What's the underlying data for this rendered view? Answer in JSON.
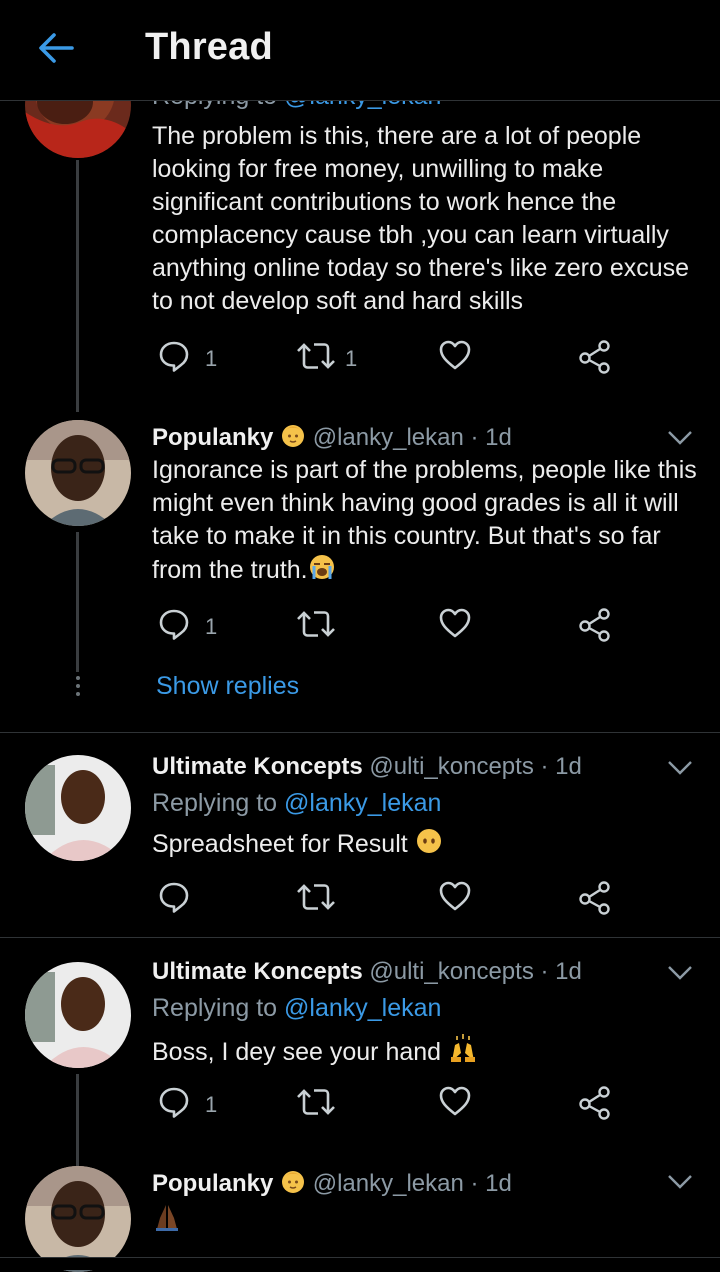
{
  "header": {
    "title": "Thread"
  },
  "tweets": [
    {
      "reply_to_prefix": "Replying to",
      "reply_to_handle": "@lanky_lekan",
      "text": "The problem is this, there are a lot of people looking for free money, unwilling to make significant contributions to work hence the complacency cause tbh ,you can learn virtually anything online today so there's like zero excuse to not develop soft and hard skills",
      "reply_count": "1",
      "retweet_count": "1"
    },
    {
      "name": "Populanky",
      "badge_icon": "baby-emoji",
      "handle": "@lanky_lekan",
      "time": "· 1d",
      "text": "Ignorance is part of the problems, people like this might even think having good grades is all it will take to make it in this country. But that's so far from the truth.",
      "text_emoji": "loudly-crying-face-emoji",
      "reply_count": "1",
      "show_replies": "Show replies"
    },
    {
      "name": "Ultimate Koncepts",
      "handle": "@ulti_koncepts",
      "time": "· 1d",
      "reply_to_prefix": "Replying to",
      "reply_to_handle": "@lanky_lekan",
      "text": "Spreadsheet for Result",
      "text_emoji": "face-without-mouth-emoji"
    },
    {
      "name": "Ultimate Koncepts",
      "handle": "@ulti_koncepts",
      "time": "· 1d",
      "reply_to_prefix": "Replying to",
      "reply_to_handle": "@lanky_lekan",
      "text": "Boss, I dey see your hand",
      "text_emoji": "raising-hands-emoji",
      "reply_count": "1"
    },
    {
      "name": "Populanky",
      "badge_icon": "baby-emoji",
      "handle": "@lanky_lekan",
      "time": "· 1d",
      "text_emoji": "folded-hands-emoji"
    }
  ],
  "colors": {
    "background": "#000000",
    "link": "#3b9ae6",
    "muted": "#8c9aa5",
    "divider": "#2f3336"
  }
}
